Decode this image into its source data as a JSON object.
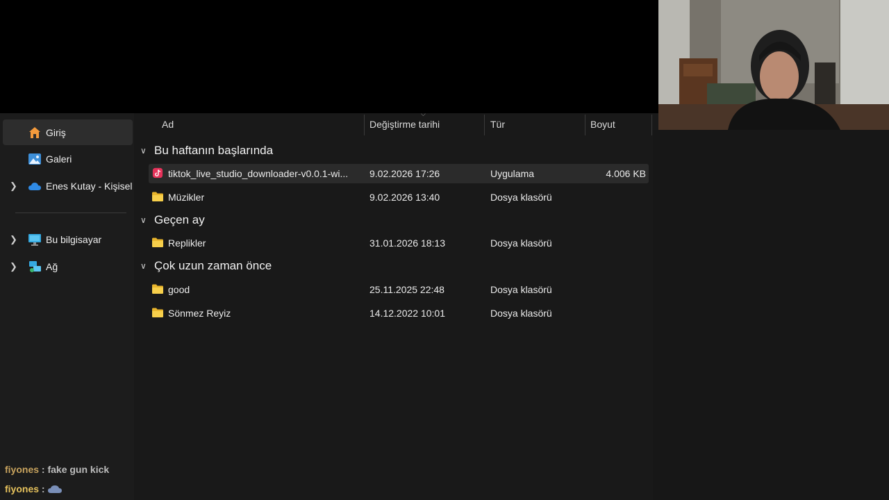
{
  "sidebar": {
    "items": [
      {
        "label": "Giriş",
        "icon": "home-icon",
        "expandable": false
      },
      {
        "label": "Galeri",
        "icon": "gallery-icon",
        "expandable": false
      },
      {
        "label": "Enes Kutay - Kişisel",
        "icon": "onedrive-cloud-icon",
        "expandable": true
      },
      {
        "label": "Bu bilgisayar",
        "icon": "computer-icon",
        "expandable": true
      },
      {
        "label": "Ağ",
        "icon": "network-icon",
        "expandable": true
      }
    ]
  },
  "columns": {
    "name": "Ad",
    "date": "Değiştirme tarihi",
    "type": "Tür",
    "size": "Boyut"
  },
  "groups": [
    {
      "title": "Bu haftanın başlarında",
      "rows": [
        {
          "name": "tiktok_live_studio_downloader-v0.0.1-wi...",
          "date": "9.02.2026 17:26",
          "type": "Uygulama",
          "size": "4.006 KB",
          "icon": "tiktok-app-icon",
          "selected": true
        },
        {
          "name": "Müzikler",
          "date": "9.02.2026 13:40",
          "type": "Dosya klasörü",
          "size": "",
          "icon": "folder-icon"
        }
      ]
    },
    {
      "title": "Geçen ay",
      "rows": [
        {
          "name": "Replikler",
          "date": "31.01.2026 18:13",
          "type": "Dosya klasörü",
          "size": "",
          "icon": "folder-icon"
        }
      ]
    },
    {
      "title": "Çok uzun zaman önce",
      "rows": [
        {
          "name": "good",
          "date": "25.11.2025 22:48",
          "type": "Dosya klasörü",
          "size": "",
          "icon": "folder-icon"
        },
        {
          "name": "Sönmez Reyiz",
          "date": "14.12.2022 10:01",
          "type": "Dosya klasörü",
          "size": "",
          "icon": "folder-icon"
        }
      ]
    }
  ],
  "chat": [
    {
      "user": "fiyones",
      "sep": " : ",
      "message": "fake gun kick"
    },
    {
      "user": "fiyones",
      "sep": " : ",
      "message": "",
      "emote": "cloud-emote-icon"
    }
  ],
  "colors": {
    "background": "#191919",
    "sidebar": "#1c1c1c",
    "selected_row": "#2b2b2b",
    "folder_yellow": "#f4c842",
    "chat_username": "#c8a35e"
  }
}
